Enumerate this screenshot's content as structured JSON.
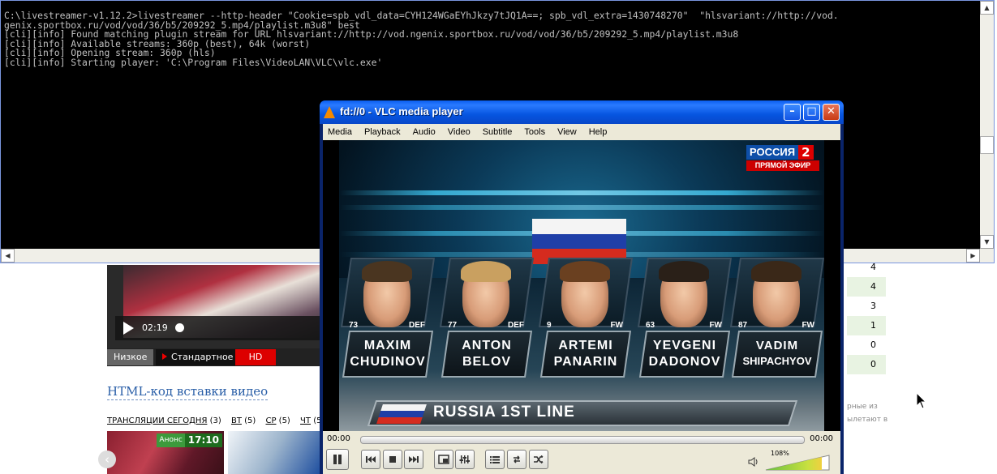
{
  "webpage": {
    "video": {
      "time": "02:19"
    },
    "quality": {
      "low": "Низкое",
      "standard": "Стандартное",
      "hd": "HD"
    },
    "embed_link": "HTML-код вставки видео",
    "today": {
      "title": "ТРАНСЛЯЦИИ СЕГОДНЯ",
      "title_count": "(3)",
      "days": [
        {
          "label": "ВТ",
          "count": "(5)"
        },
        {
          "label": "СР",
          "count": "(5)"
        },
        {
          "label": "ЧТ",
          "count": "(5)"
        }
      ]
    },
    "thumb1": {
      "badge": "Анонс",
      "time": "17:10"
    },
    "table_values": [
      "4",
      "4",
      "3",
      "1",
      "0",
      "0"
    ],
    "side_text": [
      "рные из",
      "ылетают в"
    ]
  },
  "console": {
    "lines": [
      "C:\\livestreamer-v1.12.2>livestreamer --http-header \"Cookie=spb_vdl_data=CYH124WGaEYhJkzy7tJQ1A==; spb_vdl_extra=1430748270\"  \"hlsvariant://http://vod.",
      "genix.sportbox.ru/vod/vod/36/b5/209292_5.mp4/playlist.m3u8\" best",
      "[cli][info] Found matching plugin stream for URL hlsvariant://http://vod.ngenix.sportbox.ru/vod/vod/36/b5/209292_5.mp4/playlist.m3u8",
      "[cli][info] Available streams: 360p (best), 64k (worst)",
      "[cli][info] Opening stream: 360p (hls)",
      "[cli][info] Starting player: 'C:\\Program Files\\VideoLAN\\VLC\\vlc.exe'"
    ]
  },
  "vlc": {
    "title": "fd://0 - VLC media player",
    "menu": [
      "Media",
      "Playback",
      "Audio",
      "Video",
      "Subtitle",
      "Tools",
      "View",
      "Help"
    ],
    "time_elapsed": "00:00",
    "time_total": "00:00",
    "volume": "108%",
    "accent": "#f58a00",
    "video": {
      "channel": {
        "name": "РОССИЯ",
        "number": "2",
        "live": "ПРЯМОЙ ЭФИР"
      },
      "banner": "RUSSIA 1ST LINE",
      "players": [
        {
          "number": "73",
          "position": "DEF",
          "first": "MAXIM",
          "last": "CHUDINOV"
        },
        {
          "number": "77",
          "position": "DEF",
          "first": "ANTON",
          "last": "BELOV"
        },
        {
          "number": "9",
          "position": "FW",
          "first": "ARTEMI",
          "last": "PANARIN"
        },
        {
          "number": "63",
          "position": "FW",
          "first": "YEVGENI",
          "last": "DADONOV"
        },
        {
          "number": "87",
          "position": "FW",
          "first": "VADIM",
          "last": "SHIPACHYOV"
        }
      ]
    }
  }
}
